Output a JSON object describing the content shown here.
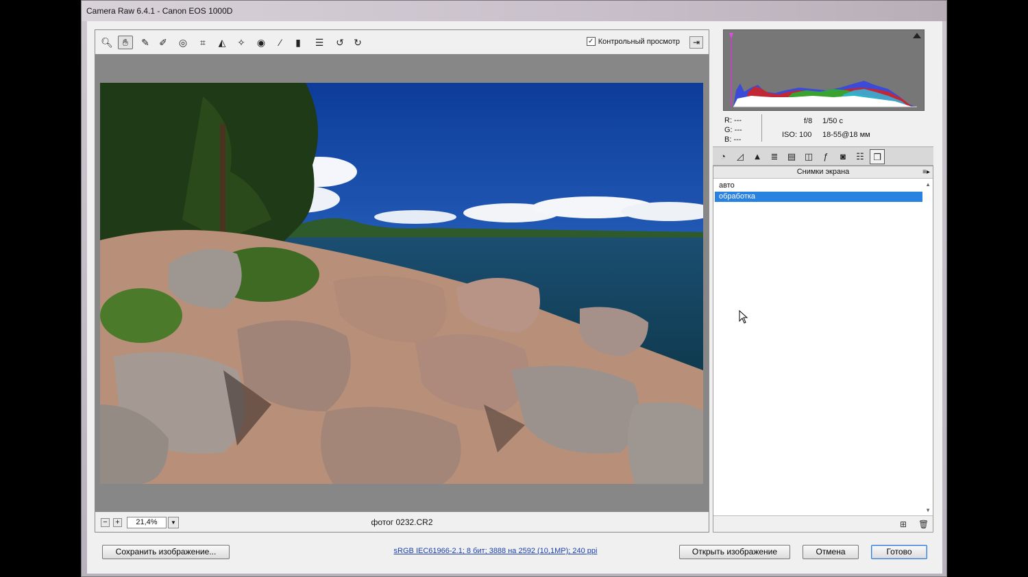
{
  "window": {
    "title": "Camera Raw 6.4.1  -  Canon EOS 1000D"
  },
  "toolbar": {
    "tools": [
      {
        "name": "zoom-tool-icon",
        "glyph": "🔍︎"
      },
      {
        "name": "hand-tool-icon",
        "glyph": "✋︎"
      },
      {
        "name": "white-balance-tool-icon",
        "glyph": "✎"
      },
      {
        "name": "color-sampler-tool-icon",
        "glyph": "✐"
      },
      {
        "name": "targeted-adjustment-tool-icon",
        "glyph": "◎"
      },
      {
        "name": "crop-tool-icon",
        "glyph": "⌗"
      },
      {
        "name": "straighten-tool-icon",
        "glyph": "◭"
      },
      {
        "name": "spot-removal-tool-icon",
        "glyph": "✧"
      },
      {
        "name": "red-eye-tool-icon",
        "glyph": "◉"
      },
      {
        "name": "adjustment-brush-icon",
        "glyph": "⁄"
      },
      {
        "name": "graduated-filter-icon",
        "glyph": "▮"
      },
      {
        "name": "preferences-icon",
        "glyph": "☰"
      },
      {
        "name": "rotate-left-icon",
        "glyph": "↺"
      },
      {
        "name": "rotate-right-icon",
        "glyph": "↻"
      }
    ],
    "preview_label": "Контрольный просмотр",
    "preview_checked": "✓"
  },
  "bottombar": {
    "zoom_minus": "−",
    "zoom_plus": "+",
    "zoom_value": "21,4%",
    "zoom_dropdown": "▼",
    "filename": "фотог 0232.CR2"
  },
  "info": {
    "r": "R:  ---",
    "g": "G:  ---",
    "b": "B:  ---",
    "aperture": "f/8",
    "shutter": "1/50 с",
    "iso": "ISO: 100",
    "lens": "18-55@18 мм"
  },
  "panel": {
    "title": "Снимки экрана",
    "snapshots": [
      "авто",
      "обработка"
    ],
    "selected_index": 1
  },
  "footer": {
    "save_label": "Сохранить изображение...",
    "workflow_link": "sRGB IEC61966-2.1; 8 бит; 3888 на 2592 (10,1MP); 240 ppi",
    "open_label": "Открыть изображение",
    "cancel_label": "Отмена",
    "done_label": "Готово"
  },
  "colors": {
    "selection": "#2a82e0",
    "link": "#1a3fa8",
    "canvas_bg": "#878787"
  }
}
